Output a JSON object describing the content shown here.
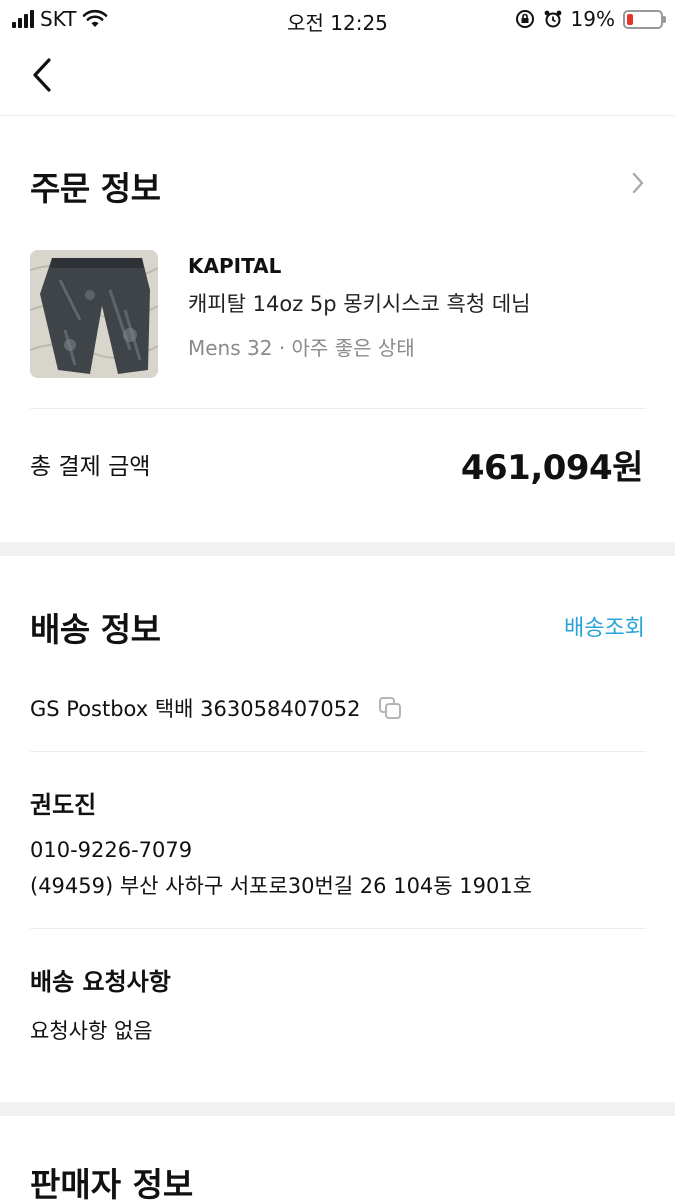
{
  "status": {
    "carrier": "SKT",
    "time": "오전 12:25",
    "battery_percent": "19%",
    "battery_level": 0.19,
    "battery_color": "#e5352b"
  },
  "nav": {
    "back_icon": "chevron-left-icon"
  },
  "order": {
    "title": "주문 정보",
    "brand": "KAPITAL",
    "product_name": "캐피탈 14oz 5p 몽키시스코 흑청 데님",
    "product_meta": "Mens 32 · 아주 좋은 상태",
    "total_label": "총 결제 금액",
    "total_value": "461,094원"
  },
  "shipping": {
    "title": "배송 정보",
    "track_label": "배송조회",
    "track_color": "#2aa3d8",
    "tracking_line": "GS Postbox 택배 363058407052",
    "recipient_name": "권도진",
    "phone": "010-9226-7079",
    "address": "(49459) 부산 사하구 서포로30번길 26 104동 1901호",
    "request_title": "배송 요청사항",
    "request_text": "요청사항 없음"
  },
  "seller": {
    "title": "판매자 정보"
  }
}
